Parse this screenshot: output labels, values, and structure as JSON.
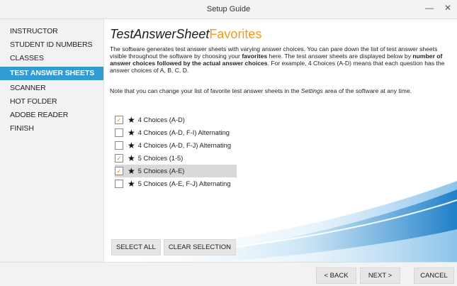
{
  "window": {
    "title": "Setup Guide",
    "minimize_glyph": "—",
    "close_glyph": "✕"
  },
  "sidebar": {
    "items": [
      {
        "label": "INSTRUCTOR",
        "active": false
      },
      {
        "label": "STUDENT ID NUMBERS",
        "active": false
      },
      {
        "label": "CLASSES",
        "active": false
      },
      {
        "label": "TEST ANSWER SHEETS",
        "active": true
      },
      {
        "label": "SCANNER",
        "active": false
      },
      {
        "label": "HOT FOLDER",
        "active": false
      },
      {
        "label": "ADOBE READER",
        "active": false
      },
      {
        "label": "FINISH",
        "active": false
      }
    ]
  },
  "main": {
    "title_part1": "TestAnswerSheet",
    "title_part2": "Favorites",
    "intro_part1": "The software generates test answer sheets with varying answer choices. You can pare down the list of test answer sheets visible throughout the software by choosing your ",
    "intro_bold1": "favorites",
    "intro_part2": " here. The test answer sheets are displayed below by ",
    "intro_bold2": "number of answer choices followed by the actual answer choices",
    "intro_part3": ". For example, 4 Choices (A-D) means that each question has the answer choices of A, B, C, D.",
    "note_part1": "Note that you can change your list of favorite test answer sheets in the ",
    "note_italic": "Settings",
    "note_part2": " area of the software at any time.",
    "choices": [
      {
        "label": "4 Choices (A-D)",
        "checked": true,
        "highlighted": false
      },
      {
        "label": "4 Choices (A-D, F-I) Alternating",
        "checked": false,
        "highlighted": false
      },
      {
        "label": "4 Choices (A-D, F-J) Alternating",
        "checked": false,
        "highlighted": false
      },
      {
        "label": "5 Choices (1-5)",
        "checked": true,
        "highlighted": false
      },
      {
        "label": "5 Choices (A-E)",
        "checked": true,
        "highlighted": true
      },
      {
        "label": "5 Choices (A-E, F-J) Alternating",
        "checked": false,
        "highlighted": false
      }
    ],
    "check_glyph": "✓",
    "star_glyph": "★",
    "select_all_label": "SELECT ALL",
    "clear_selection_label": "CLEAR SELECTION"
  },
  "footer": {
    "back_label": "< BACK",
    "next_label": "NEXT >",
    "cancel_label": "CANCEL"
  },
  "colors": {
    "accent": "#2f9cd6",
    "title_orange": "#f29a1e",
    "check_orange": "#e0872a"
  }
}
